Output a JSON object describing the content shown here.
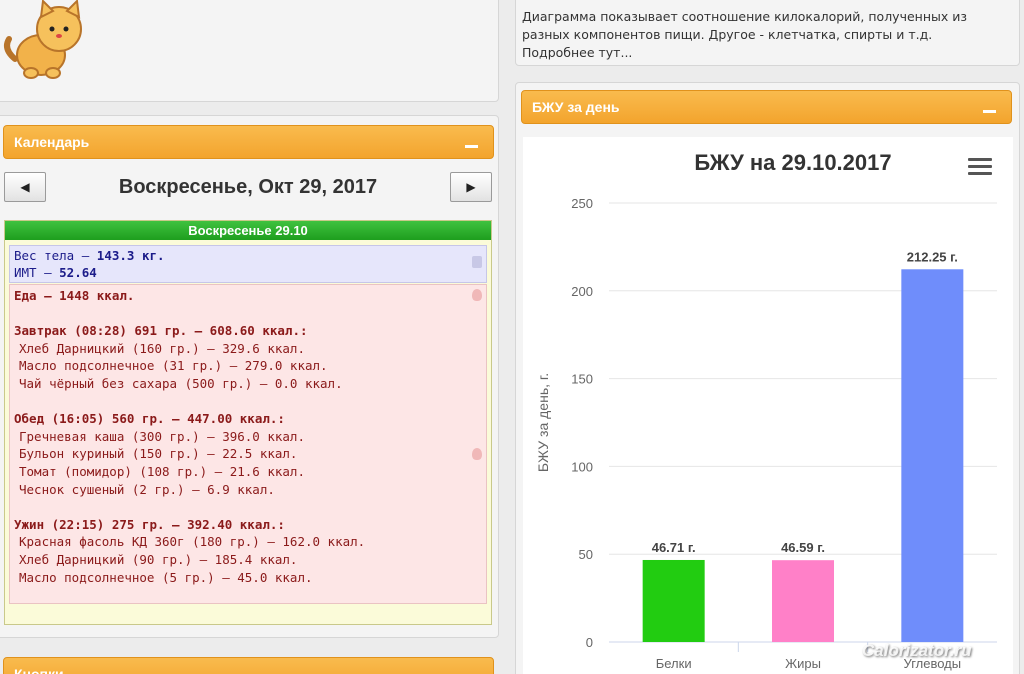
{
  "calendar": {
    "header": "Календарь",
    "prev_glyph": "◀",
    "next_glyph": "▶",
    "date": "Воскресенье, Окт 29, 2017",
    "day_title": "Воскресенье 29.10",
    "weight_label": "Вес тела — ",
    "weight_value": "143.3 кг.",
    "bmi_label": "ИМТ — ",
    "bmi_value": "52.64",
    "food_total": "Еда — 1448 ккал.",
    "meals": [
      {
        "head": "Завтрак (08:28) 691 гр. — 608.60 ккал.:",
        "items": [
          "Хлеб Дарницкий (160 гр.) — 329.6 ккал.",
          "Масло подсолнечное (31 гр.) — 279.0 ккал.",
          "Чай чёрный без сахара (500 гр.) — 0.0 ккал."
        ]
      },
      {
        "head": "Обед (16:05) 560 гр. — 447.00 ккал.:",
        "items": [
          "Гречневая каша (300 гр.) — 396.0 ккал.",
          "Бульон куриный (150 гр.) — 22.5 ккал.",
          "Томат (помидор) (108 гр.) — 21.6 ккал.",
          "Чеснок сушеный (2 гр.) — 6.9 ккал."
        ]
      },
      {
        "head": "Ужин (22:15) 275 гр. — 392.40 ккал.:",
        "items": [
          "Красная фасоль КД 360г (180 гр.) — 162.0 ккал.",
          "Хлеб Дарницкий (90 гр.) — 185.4 ккал.",
          "Масло подсолнечное (5 гр.) — 45.0 ккал."
        ]
      }
    ]
  },
  "bottom_header": "Кнопки",
  "info": {
    "text": "Диаграмма показывает соотношение килокалорий, полученных из разных компонентов пищи. Другое - клетчатка, спирты и т.д. Подробнее тут..."
  },
  "bju_panel": {
    "header": "БЖУ за день"
  },
  "watermark": "Calorizator.ru",
  "colors": {
    "accent_orange": "#f3a42d",
    "green_header": "#1e9e1e"
  },
  "chart_data": {
    "type": "bar",
    "title": "БЖУ на 29.10.2017",
    "ylabel": "БЖУ за день, г.",
    "xlabel": "",
    "ylim": [
      0,
      250
    ],
    "yticks": [
      0,
      50,
      100,
      150,
      200,
      250
    ],
    "categories": [
      "Белки",
      "Жиры",
      "Углеводы"
    ],
    "values": [
      46.71,
      46.59,
      212.25
    ],
    "data_labels": [
      "46.71 г.",
      "46.59 г.",
      "212.25 г."
    ],
    "bar_colors": [
      "#22cc11",
      "#ff80c8",
      "#6f8dfb"
    ]
  }
}
